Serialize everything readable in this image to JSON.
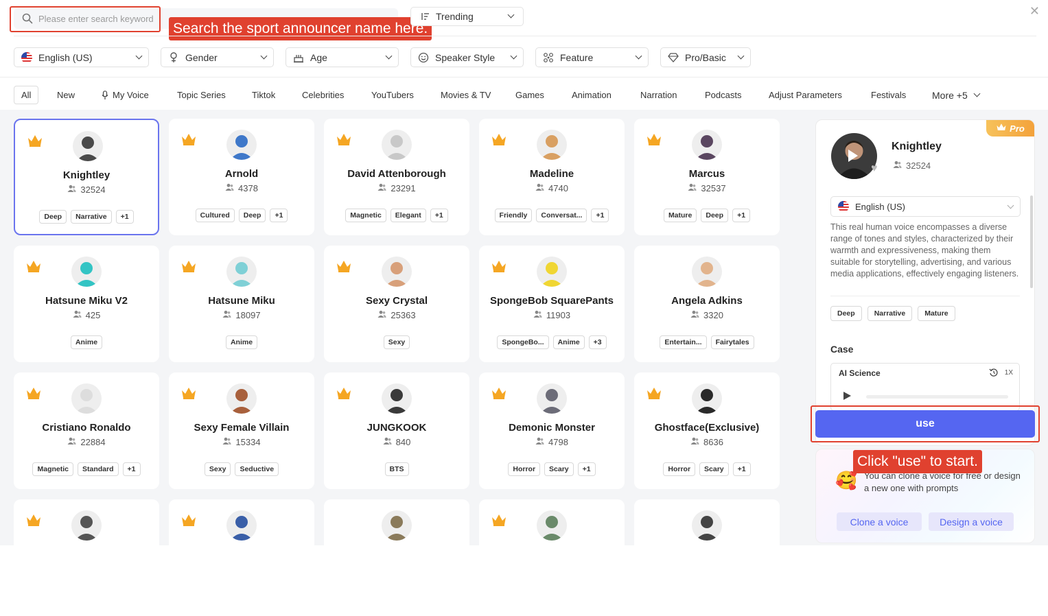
{
  "search": {
    "placeholder": "Please enter search keyword"
  },
  "callouts": {
    "search_hint": "Search the sport announcer name here.",
    "use_hint": "Click \"use\" to start."
  },
  "sort": {
    "label": "Trending"
  },
  "filters": [
    {
      "label": "English (US)",
      "icon": "us-flag-icon"
    },
    {
      "label": "Gender",
      "icon": "gender-icon"
    },
    {
      "label": "Age",
      "icon": "cake-icon"
    },
    {
      "label": "Speaker Style",
      "icon": "smile-icon"
    },
    {
      "label": "Feature",
      "icon": "feature-icon"
    },
    {
      "label": "Pro/Basic",
      "icon": "diamond-icon"
    }
  ],
  "tabs": [
    "All",
    "New",
    "My Voice",
    "Topic Series",
    "Tiktok",
    "Celebrities",
    "YouTubers",
    "Movies & TV",
    "Games",
    "Animation",
    "Narration",
    "Podcasts",
    "Adjust Parameters",
    "Festivals",
    "More +5"
  ],
  "cards": [
    {
      "name": "Knightley",
      "count": "32524",
      "tags": [
        "Deep",
        "Narrative",
        "+1"
      ],
      "pro": true,
      "avatar": "#4a4a4a"
    },
    {
      "name": "Arnold",
      "count": "4378",
      "tags": [
        "Cultured",
        "Deep",
        "+1"
      ],
      "pro": true,
      "avatar": "#3f78c9"
    },
    {
      "name": "David Attenborough",
      "count": "23291",
      "tags": [
        "Magnetic",
        "Elegant",
        "+1"
      ],
      "pro": true,
      "avatar": "#c8c8c8"
    },
    {
      "name": "Madeline",
      "count": "4740",
      "tags": [
        "Friendly",
        "Conversat...",
        "+1"
      ],
      "pro": true,
      "avatar": "#d9a062"
    },
    {
      "name": "Marcus",
      "count": "32537",
      "tags": [
        "Mature",
        "Deep",
        "+1"
      ],
      "pro": true,
      "avatar": "#5a4660"
    },
    {
      "name": "Hatsune Miku V2",
      "count": "425",
      "tags": [
        "Anime"
      ],
      "pro": true,
      "avatar": "#33c4c4"
    },
    {
      "name": "Hatsune Miku",
      "count": "18097",
      "tags": [
        "Anime"
      ],
      "pro": true,
      "avatar": "#7fd0d6"
    },
    {
      "name": "Sexy Crystal",
      "count": "25363",
      "tags": [
        "Sexy"
      ],
      "pro": true,
      "avatar": "#d8a07a"
    },
    {
      "name": "SpongeBob SquarePants",
      "count": "11903",
      "tags": [
        "SpongeBo...",
        "Anime",
        "+3"
      ],
      "pro": true,
      "avatar": "#f0d633"
    },
    {
      "name": "Angela Adkins",
      "count": "3320",
      "tags": [
        "Entertain...",
        "Fairytales"
      ],
      "pro": false,
      "avatar": "#e2b48d"
    },
    {
      "name": "Cristiano Ronaldo",
      "count": "22884",
      "tags": [
        "Magnetic",
        "Standard",
        "+1"
      ],
      "pro": true,
      "avatar": "#dddddd"
    },
    {
      "name": "Sexy Female Villain",
      "count": "15334",
      "tags": [
        "Sexy",
        "Seductive"
      ],
      "pro": true,
      "avatar": "#a8603c"
    },
    {
      "name": "JUNGKOOK",
      "count": "840",
      "tags": [
        "BTS"
      ],
      "pro": true,
      "avatar": "#3a3a3a"
    },
    {
      "name": "Demonic Monster",
      "count": "4798",
      "tags": [
        "Horror",
        "Scary",
        "+1"
      ],
      "pro": true,
      "avatar": "#6c6c78"
    },
    {
      "name": "Ghostface(Exclusive)",
      "count": "8636",
      "tags": [
        "Horror",
        "Scary",
        "+1"
      ],
      "pro": true,
      "avatar": "#2a2a2a"
    },
    {
      "name": "",
      "count": "",
      "tags": [],
      "pro": true,
      "avatar": "#555555"
    },
    {
      "name": "",
      "count": "",
      "tags": [],
      "pro": true,
      "avatar": "#3a5fa8"
    },
    {
      "name": "",
      "count": "",
      "tags": [],
      "pro": false,
      "avatar": "#8a7a5a"
    },
    {
      "name": "",
      "count": "",
      "tags": [],
      "pro": true,
      "avatar": "#6a8a6a"
    },
    {
      "name": "",
      "count": "",
      "tags": [],
      "pro": false,
      "avatar": "#444444"
    }
  ],
  "detail": {
    "badge": "Pro",
    "name": "Knightley",
    "count": "32524",
    "language": "English (US)",
    "description": "This real human voice encompasses a diverse range of tones and styles, characterized by their warmth and expressiveness, making them suitable for storytelling, advertising, and various media applications, effectively engaging listeners.",
    "tags": [
      "Deep",
      "Narrative",
      "Mature"
    ],
    "case_label": "Case",
    "case_title": "AI Science",
    "case_speed": "1X"
  },
  "use_button": "use",
  "promo": {
    "text": "You can clone a voice for free or design a new one with prompts",
    "clone_button": "Clone a voice",
    "design_button": "Design a voice"
  },
  "colors": {
    "accent": "#5566f1",
    "annotation": "#e0412f",
    "crown": "#f5a623"
  }
}
